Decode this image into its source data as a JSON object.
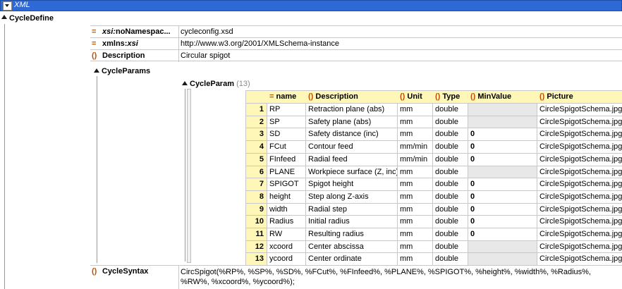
{
  "header": {
    "title": "XML"
  },
  "root": {
    "label": "CycleDefine"
  },
  "attributes": [
    {
      "prefix": "=",
      "name": "xsi:noNamespac...",
      "value": "cycleconfig.xsd"
    },
    {
      "prefix": "=",
      "name": "xmlns:xsi",
      "value": "http://www.w3.org/2001/XMLSchema-instance"
    },
    {
      "prefix": "()",
      "name": "Description",
      "value": "Circular spigot"
    }
  ],
  "cycleParams": {
    "label": "CycleParams",
    "child": {
      "label": "CycleParam",
      "count": "(13)"
    }
  },
  "table": {
    "headers": [
      "name",
      "Description",
      "Unit",
      "Type",
      "MinValue",
      "Picture"
    ],
    "rows": [
      {
        "n": "1",
        "name": "RP",
        "desc": "Retraction plane (abs)",
        "unit": "mm",
        "type": "double",
        "min": "",
        "pic": "CircleSpigotSchema.jpg"
      },
      {
        "n": "2",
        "name": "SP",
        "desc": "Safety plane (abs)",
        "unit": "mm",
        "type": "double",
        "min": "",
        "pic": "CircleSpigotSchema.jpg"
      },
      {
        "n": "3",
        "name": "SD",
        "desc": "Safety distance (inc)",
        "unit": "mm",
        "type": "double",
        "min": "0",
        "pic": "CircleSpigotSchema.jpg"
      },
      {
        "n": "4",
        "name": "FCut",
        "desc": "Contour feed",
        "unit": "mm/min",
        "type": "double",
        "min": "0",
        "pic": "CircleSpigotSchema.jpg"
      },
      {
        "n": "5",
        "name": "FInfeed",
        "desc": "Radial feed",
        "unit": "mm/min",
        "type": "double",
        "min": "0",
        "pic": "CircleSpigotSchema.jpg"
      },
      {
        "n": "6",
        "name": "PLANE",
        "desc": "Workpiece surface (Z, inc)",
        "unit": "mm",
        "type": "double",
        "min": "",
        "pic": "CircleSpigotSchema.jpg"
      },
      {
        "n": "7",
        "name": "SPIGOT",
        "desc": "Spigot height",
        "unit": "mm",
        "type": "double",
        "min": "0",
        "pic": "CircleSpigotSchema.jpg"
      },
      {
        "n": "8",
        "name": "height",
        "desc": "Step along Z-axis",
        "unit": "mm",
        "type": "double",
        "min": "0",
        "pic": "CircleSpigotSchema.jpg"
      },
      {
        "n": "9",
        "name": "width",
        "desc": "Radial step",
        "unit": "mm",
        "type": "double",
        "min": "0",
        "pic": "CircleSpigotSchema.jpg"
      },
      {
        "n": "10",
        "name": "Radius",
        "desc": "Initial radius",
        "unit": "mm",
        "type": "double",
        "min": "0",
        "pic": "CircleSpigotSchema.jpg"
      },
      {
        "n": "11",
        "name": "RW",
        "desc": "Resulting radius",
        "unit": "mm",
        "type": "double",
        "min": "0",
        "pic": "CircleSpigotSchema.jpg"
      },
      {
        "n": "12",
        "name": "xcoord",
        "desc": "Center abscissa",
        "unit": "mm",
        "type": "double",
        "min": "",
        "pic": "CircleSpigotSchema.jpg"
      },
      {
        "n": "13",
        "name": "ycoord",
        "desc": "Center ordinate",
        "unit": "mm",
        "type": "double",
        "min": "",
        "pic": "CircleSpigotSchema.jpg"
      }
    ]
  },
  "cycleSyntax": {
    "label": "CycleSyntax",
    "line1": "CircSpigot(%RP%, %SP%, %SD%, %FCut%, %FInfeed%, %PLANE%, %SPIGOT%, %height%, %width%, %Radius%,",
    "line2": "%RW%, %xcoord%, %ycoord%);"
  }
}
